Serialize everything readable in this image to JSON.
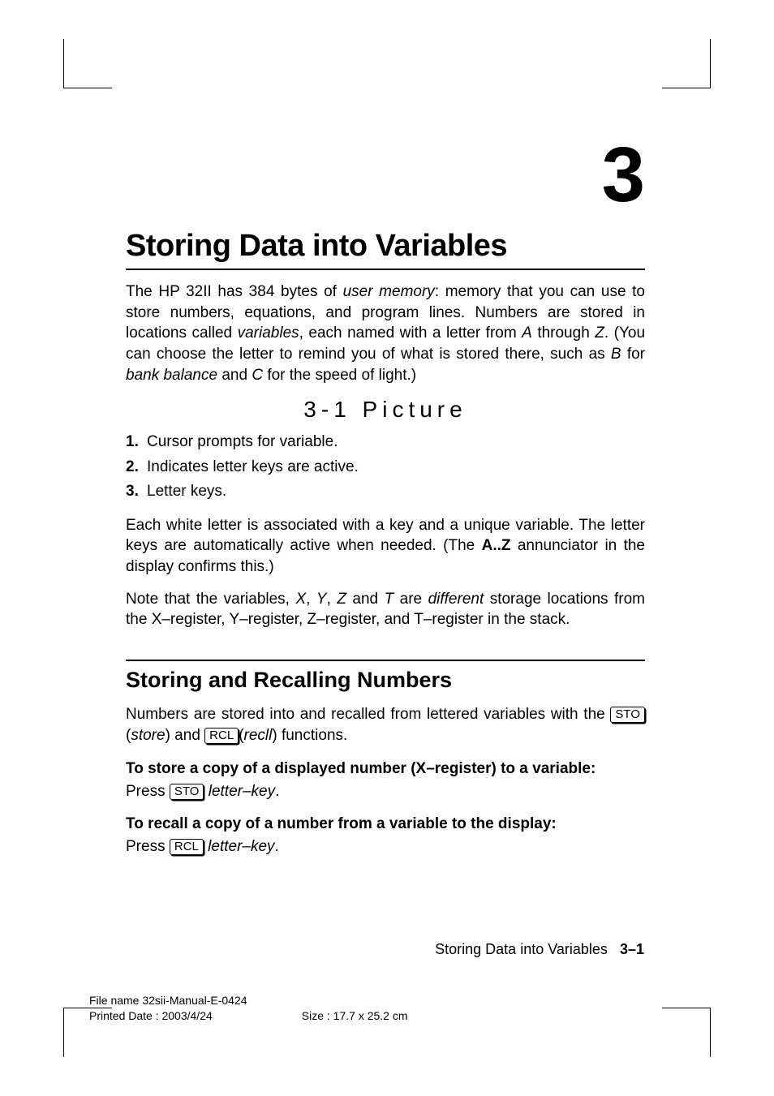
{
  "chapter": {
    "number": "3",
    "title": "Storing Data into Variables"
  },
  "intro": {
    "p1a": "The HP 32II has 384 bytes of ",
    "p1_mem": "user memory",
    "p1b": ": memory that you can use to store numbers, equations, and program lines. Numbers are stored in locations called ",
    "p1_var": "variables",
    "p1c": ", each named with a letter from ",
    "p1_A": "A",
    "p1d": " through ",
    "p1_Z": "Z",
    "p1e": ". (You can choose the letter to remind you of what is stored there, such as ",
    "p1_Bex": "B",
    "p1f": " for ",
    "p1_bb": "bank balance",
    "p1g": " and ",
    "p1_C": "C",
    "p1h": " for the speed of light.)"
  },
  "picture": {
    "label": "3-1 Picture"
  },
  "numlist": {
    "items": [
      {
        "n": "1.",
        "text": "Cursor prompts for variable."
      },
      {
        "n": "2.",
        "text": "Indicates letter keys are active."
      },
      {
        "n": "3.",
        "text": "Letter keys."
      }
    ]
  },
  "para2": {
    "a": "Each white letter is associated with a key and a unique variable. The letter keys are automatically active when needed. (The ",
    "az": "A..Z",
    "b": " annunciator in the display confirms this.)"
  },
  "para3": {
    "a": "Note that the variables, ",
    "x": "X",
    "c1": ", ",
    "y": "Y",
    "c2": ", ",
    "z": "Z",
    "c3": " and ",
    "t": "T",
    "c4": " are ",
    "diff": "different",
    "b": " storage locations from the X–register, Y–register, Z–register, and T–register in the stack."
  },
  "section1": {
    "title": "Storing and Recalling Numbers",
    "p": {
      "a": "Numbers are stored into and recalled from lettered variables with the ",
      "sto": "STO",
      "b": " (",
      "store": "store",
      "c": ") and ",
      "rcl": "RCL",
      "d": "(",
      "recll": "recll",
      "e": ") functions."
    },
    "sub1": "To store a copy of a displayed number (X–register) to a variable:",
    "press1": {
      "a": "Press ",
      "key": "STO",
      "b": " ",
      "arg": "letter–key",
      "c": "."
    },
    "sub2": "To recall a copy of a number from a variable to the display:",
    "press2": {
      "a": "Press ",
      "key": "RCL",
      "b": " ",
      "arg": "letter–key",
      "c": "."
    }
  },
  "footer": {
    "right_title": "Storing Data into Variables",
    "right_page": "3–1",
    "filename": "File name 32sii-Manual-E-0424",
    "printed": "Printed Date : 2003/4/24",
    "size": "Size : 17.7 x 25.2 cm"
  }
}
